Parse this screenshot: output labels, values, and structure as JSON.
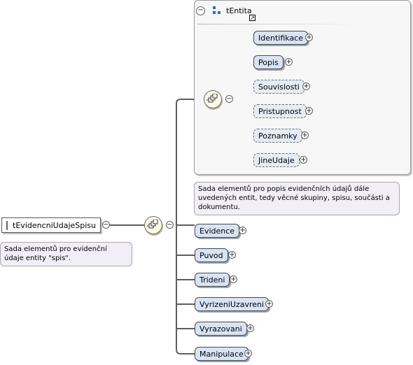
{
  "root": {
    "name": "tEvidencniUdajeSpisu",
    "doc": "Sada elementů pro evidenční údaje entity \"spis\"."
  },
  "type_block": {
    "title": "tEntita",
    "doc": "Sada elementů pro popis evidenčních údajů dále uvedených entit, tedy věcné skupiny, spisu, součásti a dokumentu.",
    "elements": [
      {
        "name": "Identifikace",
        "optional": false
      },
      {
        "name": "Popis",
        "optional": false
      },
      {
        "name": "Souvislosti",
        "optional": true
      },
      {
        "name": "Pristupnost",
        "optional": true
      },
      {
        "name": "Poznamky",
        "optional": true
      },
      {
        "name": "JineUdaje",
        "optional": true
      }
    ]
  },
  "elements": [
    {
      "name": "Evidence",
      "optional": false
    },
    {
      "name": "Puvod",
      "optional": false
    },
    {
      "name": "Trideni",
      "optional": false
    },
    {
      "name": "VyrizeniUzavreni",
      "optional": false
    },
    {
      "name": "Vyrazovani",
      "optional": false
    },
    {
      "name": "Manipulace",
      "optional": false
    }
  ],
  "symbols": {
    "expand": "+",
    "collapse": "−",
    "link": "↗"
  },
  "colors": {
    "element_fill": "#d8e4f4",
    "root_icon": "#d3c9ea",
    "doc_fill": "#f1eef8"
  }
}
